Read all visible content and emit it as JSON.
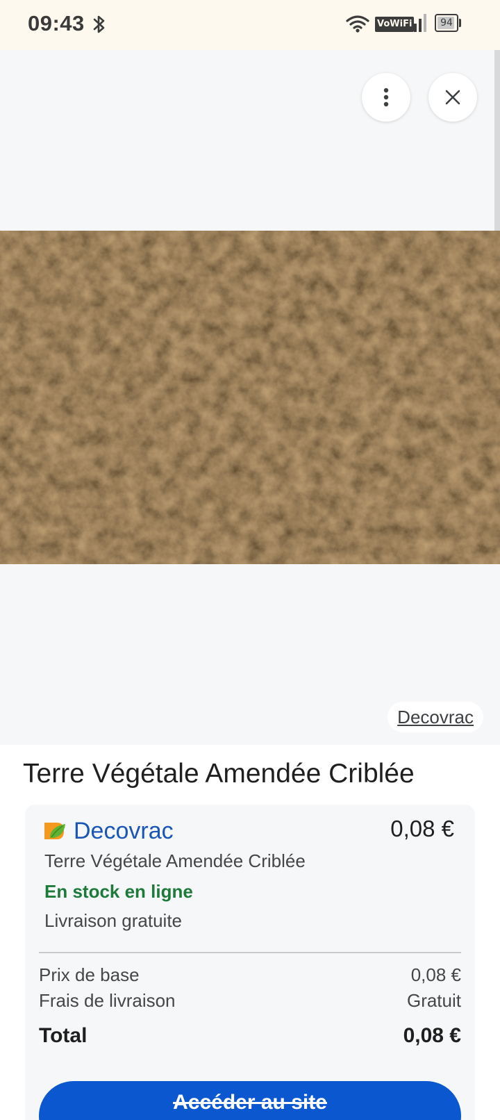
{
  "status_bar": {
    "time": "09:43",
    "network_badge": "VoWiFi",
    "battery_level": "94",
    "battery_fraction": 0.94
  },
  "viewer": {
    "more_button_icon": "more-vert-icon",
    "close_button_icon": "close-icon",
    "image_icon": "soil-texture-image",
    "source_label": "Decovrac"
  },
  "product": {
    "title": "Terre Végétale Amendée Criblée"
  },
  "offer": {
    "merchant": "Decovrac",
    "merchant_logo_icon": "decovrac-leaf-logo",
    "price": "0,08 €",
    "product_name": "Terre Végétale Amendée Criblée",
    "stock": "En stock en ligne",
    "shipping": "Livraison gratuite",
    "rows": {
      "base_label": "Prix de base",
      "base_value": "0,08 €",
      "shipping_label": "Frais de livraison",
      "shipping_value": "Gratuit",
      "total_label": "Total",
      "total_value": "0,08 €"
    },
    "cta_label": "Accéder au site"
  },
  "colors": {
    "status_bar_bg": "#fdf9ee",
    "merchant_link": "#1a56b6",
    "in_stock": "#1e7a3b",
    "cta_bg": "#0b57d0"
  }
}
